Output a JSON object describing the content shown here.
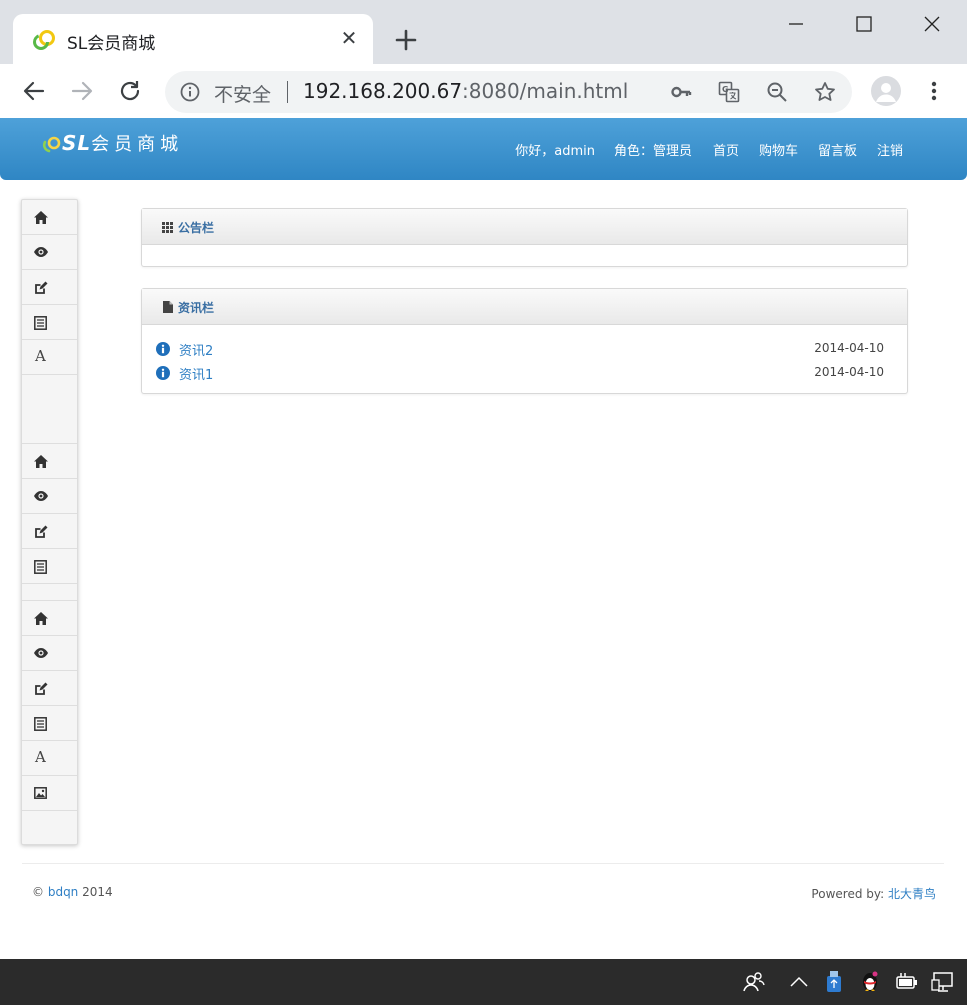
{
  "browser": {
    "tab_title": "SL会员商城",
    "security_label": "不安全",
    "url_host": "192.168.200.67",
    "url_rest": ":8080/main.html"
  },
  "header": {
    "logo_text": "SL",
    "logo_name": "会员商城",
    "greeting": "你好，admin",
    "role": "角色：管理员",
    "nav": [
      "首页",
      "购物车",
      "留言板",
      "注销"
    ]
  },
  "sidebar": {
    "group1": [
      "home-icon",
      "eye-icon",
      "edit-icon",
      "list-icon",
      "font-icon"
    ],
    "group2": [
      "home-icon",
      "eye-icon",
      "edit-icon",
      "list-icon"
    ],
    "group3": [
      "home-icon",
      "eye-icon",
      "edit-icon",
      "list-icon",
      "font-icon",
      "picture-icon"
    ]
  },
  "notice": {
    "title": "公告栏"
  },
  "news": {
    "title": "资讯栏",
    "items": [
      {
        "title": "资讯2",
        "date": "2014-04-10"
      },
      {
        "title": "资讯1",
        "date": "2014-04-10"
      }
    ]
  },
  "footer": {
    "copyright": "©",
    "company": "bdqn",
    "year": "2014",
    "powered_label": "Powered by:",
    "powered_link": "北大青鸟"
  },
  "colors": {
    "header_blue": "#3b93cf",
    "link_blue": "#2f7fc4",
    "panel_title": "#3a6fa3"
  }
}
